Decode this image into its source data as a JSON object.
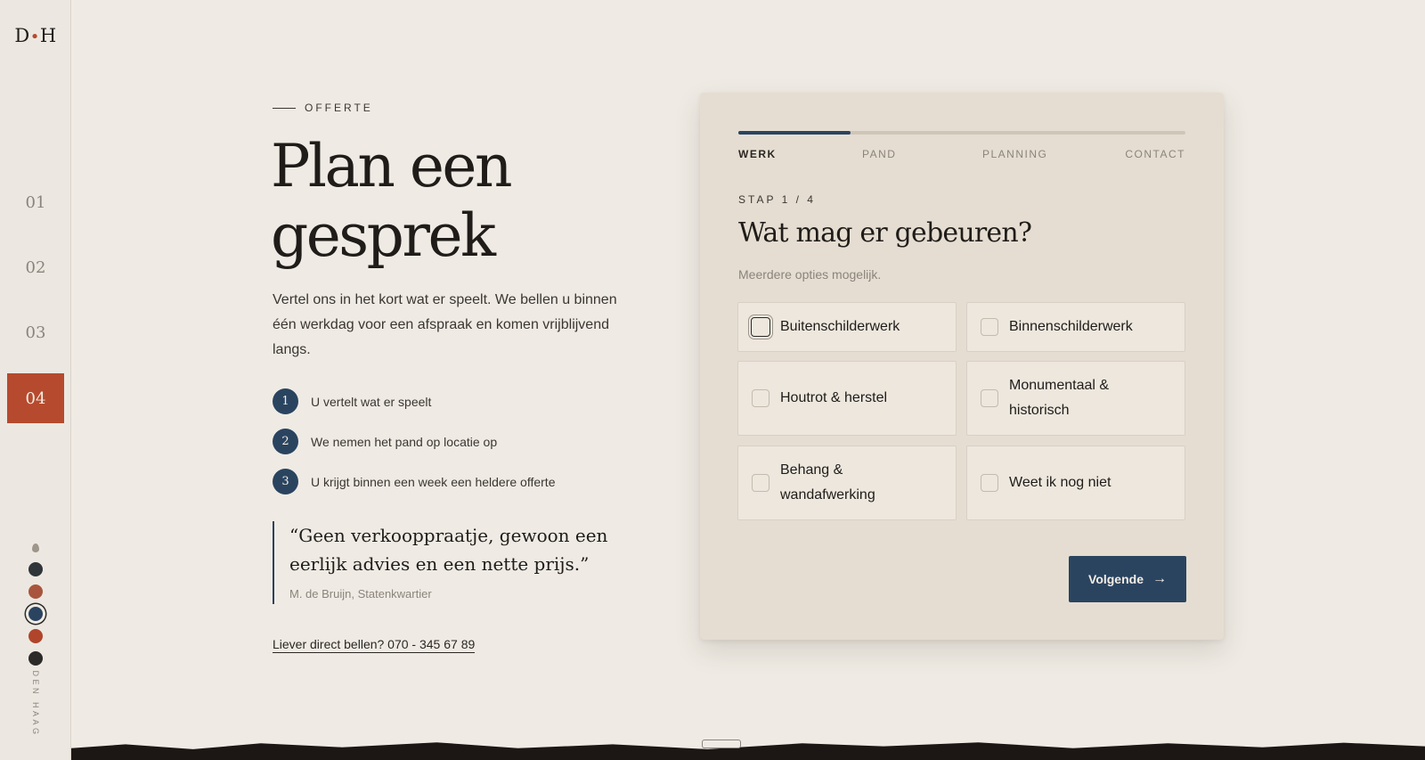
{
  "sidebar": {
    "logo_left": "D",
    "logo_dot": "•",
    "logo_right": "H",
    "nav": [
      "01",
      "02",
      "03",
      "04"
    ],
    "active_nav": "04",
    "swatch_colors": [
      "#2f3538",
      "#a9553d",
      "#2a4460",
      "#b0452c",
      "#2b2a28"
    ],
    "city": "DEN HAAG"
  },
  "hero": {
    "eyebrow": "OFFERTE",
    "headline": "Plan een gesprek",
    "lead": "Vertel ons in het kort wat er speelt. We bellen u binnen één werkdag voor een afspraak en komen vrijblijvend langs.",
    "steps": [
      {
        "num": "1",
        "text": "U vertelt wat er speelt"
      },
      {
        "num": "2",
        "text": "We nemen het pand op locatie op"
      },
      {
        "num": "3",
        "text": "U krijgt binnen een week een heldere offerte"
      }
    ],
    "quote": "“Geen verkooppraatje, gewoon een eerlijk advies en een nette prijs.”",
    "quote_author": "M. de Bruijn, Statenkwartier",
    "call_link": "Liever direct bellen? 070 - 345 67 89"
  },
  "form": {
    "progress": 0.25,
    "steps": [
      "WERK",
      "PAND",
      "PLANNING",
      "CONTACT"
    ],
    "active_step": "WERK",
    "stap_label": "STAP 1 / 4",
    "title": "Wat mag er gebeuren?",
    "subtitle": "Meerdere opties mogelijk.",
    "options": [
      {
        "label": "Buitenschilderwerk",
        "checked": false
      },
      {
        "label": "Binnenschilderwerk",
        "checked": false
      },
      {
        "label": "Houtrot & herstel",
        "checked": false
      },
      {
        "label": "Monumentaal & historisch",
        "checked": false
      },
      {
        "label": "Behang & wandafwerking",
        "checked": false
      },
      {
        "label": "Weet ik nog niet",
        "checked": false
      }
    ],
    "next_label": "Volgende",
    "next_icon": "arrow-right-icon"
  }
}
